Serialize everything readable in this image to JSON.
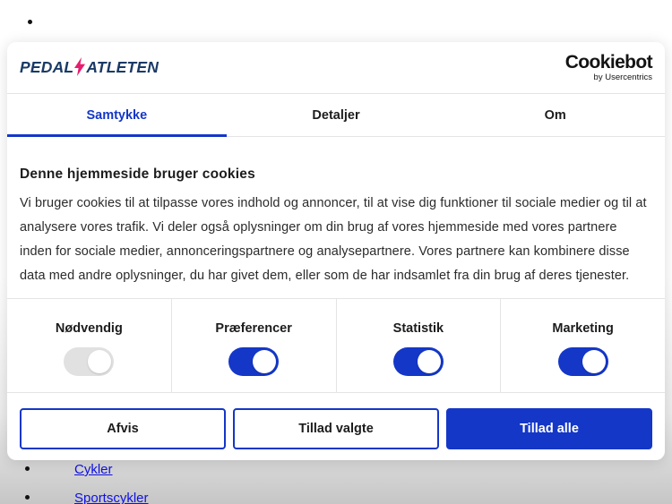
{
  "colors": {
    "accent_blue": "#1437c8",
    "link_blue": "#0f10e3",
    "toggle_off_gray": "#e1e1e1",
    "brand_navy": "#1a3a66",
    "brand_pink": "#e61e6e",
    "border_gray": "#e4e4e4"
  },
  "page_background": {
    "list_links": [
      "Cykler",
      "Sportscykler"
    ]
  },
  "banner": {
    "brand": {
      "part1": "PEDAL",
      "part2": "ATLETEN"
    },
    "vendor": {
      "name": "Cookiebot",
      "byline": "by Usercentrics"
    },
    "tabs": [
      {
        "label": "Samtykke",
        "active": true
      },
      {
        "label": "Detaljer",
        "active": false
      },
      {
        "label": "Om",
        "active": false
      }
    ],
    "heading": "Denne hjemmeside bruger cookies",
    "description": "Vi bruger cookies til at tilpasse vores indhold og annoncer, til at vise dig funktioner til sociale medier og til at analysere vores trafik. Vi deler også oplysninger om din brug af vores hjemmeside med vores partnere inden for sociale medier, annonceringspartnere og analysepartnere. Vores partnere kan kombinere disse data med andre oplysninger, du har givet dem, eller som de har indsamlet fra din brug af deres tjenester.",
    "categories": [
      {
        "label": "Nødvendig",
        "state": "on-disabled"
      },
      {
        "label": "Præferencer",
        "state": "on"
      },
      {
        "label": "Statistik",
        "state": "on"
      },
      {
        "label": "Marketing",
        "state": "on"
      }
    ],
    "buttons": [
      {
        "label": "Afvis",
        "style": "outline"
      },
      {
        "label": "Tillad valgte",
        "style": "outline"
      },
      {
        "label": "Tillad alle",
        "style": "solid"
      }
    ]
  }
}
